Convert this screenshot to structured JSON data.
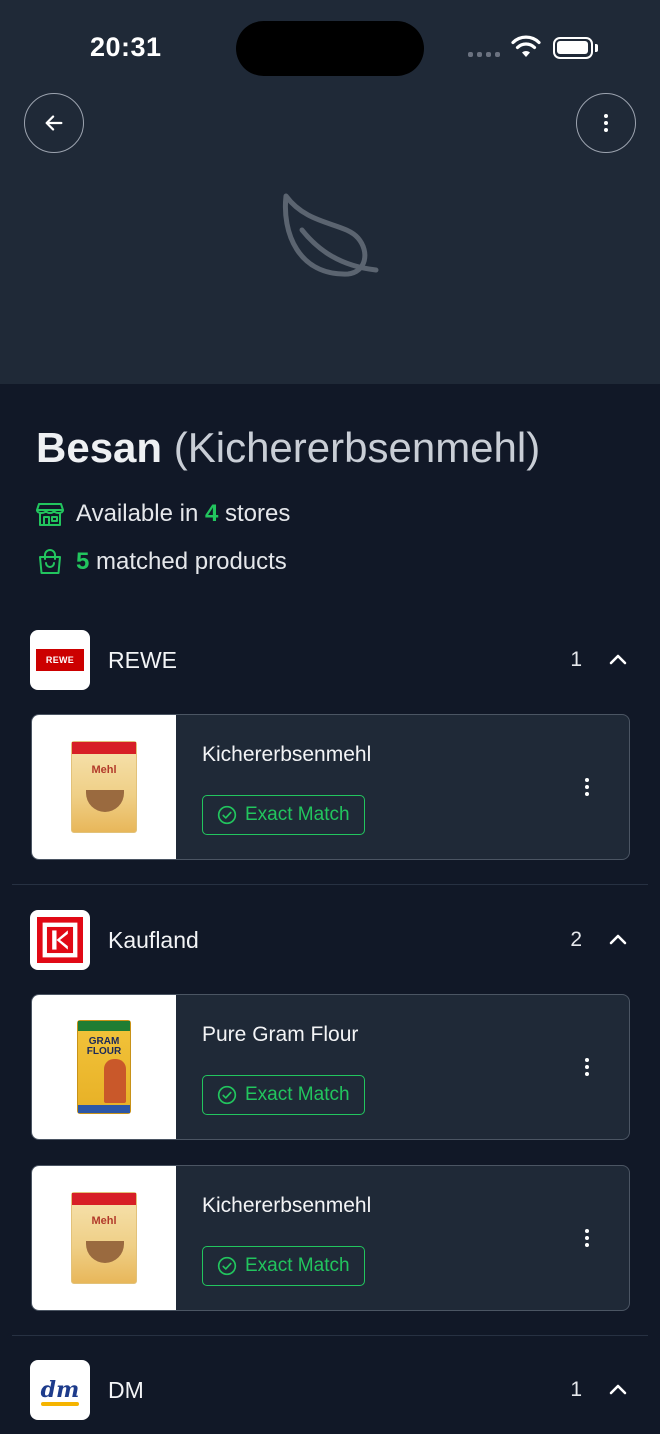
{
  "status_bar": {
    "time": "20:31"
  },
  "ingredient": {
    "name_main": "Besan",
    "name_detail": "(Kichererbsenmehl)"
  },
  "stats": {
    "stores_prefix": "Available in",
    "stores_count": "4",
    "stores_suffix": "stores",
    "products_count": "5",
    "products_suffix": "matched products"
  },
  "stores": [
    {
      "name": "REWE",
      "count": "1",
      "logo_text": "REWE",
      "products": [
        {
          "name": "Kichererbsenmehl",
          "badge": "Exact Match"
        }
      ]
    },
    {
      "name": "Kaufland",
      "count": "2",
      "products": [
        {
          "name": "Pure Gram Flour",
          "badge": "Exact Match"
        },
        {
          "name": "Kichererbsenmehl",
          "badge": "Exact Match"
        }
      ]
    },
    {
      "name": "DM",
      "count": "1",
      "logo_text": "dm",
      "products": []
    }
  ],
  "product_images": {
    "mehl_pack_text": "Mehl",
    "gram_pack_text": "GRAM FLOUR"
  },
  "colors": {
    "accent": "#22c55e",
    "background": "#111827",
    "hero": "#1f2937",
    "card": "#1f2937",
    "rewe_red": "#cc0000",
    "kaufland_red": "#e10915"
  },
  "icons": {
    "back": "arrow-left-icon",
    "more": "more-vertical-icon",
    "placeholder": "leaf-icon",
    "stores": "store-icon",
    "products": "shopping-bag-icon",
    "collapse": "chevron-up-icon",
    "badge": "check-circle-icon"
  }
}
